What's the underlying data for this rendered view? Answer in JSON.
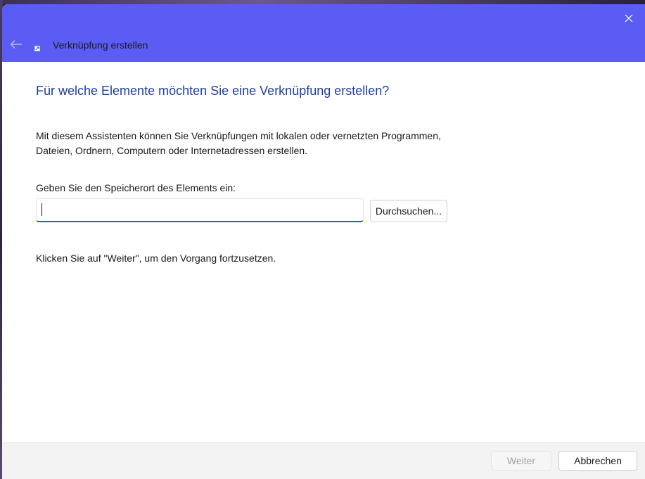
{
  "window": {
    "title": "Verknüpfung erstellen",
    "titlebar_color": "#5a5cf4"
  },
  "icons": {
    "back": "back-arrow-icon",
    "close": "close-icon",
    "app": "shortcut-icon"
  },
  "content": {
    "heading": "Für welche Elemente möchten Sie eine Verknüpfung erstellen?",
    "description_line1": "Mit diesem Assistenten können Sie Verknüpfungen mit lokalen oder vernetzten Programmen,",
    "description_line2": "Dateien, Ordnern, Computern oder Internetadressen erstellen.",
    "field_label": "Geben Sie den Speicherort des Elements ein:",
    "location_value": "",
    "browse_label": "Durchsuchen...",
    "hint": "Klicken Sie auf \"Weiter\", um den Vorgang fortzusetzen."
  },
  "footer": {
    "next_label": "Weiter",
    "next_enabled": false,
    "cancel_label": "Abbrechen"
  }
}
